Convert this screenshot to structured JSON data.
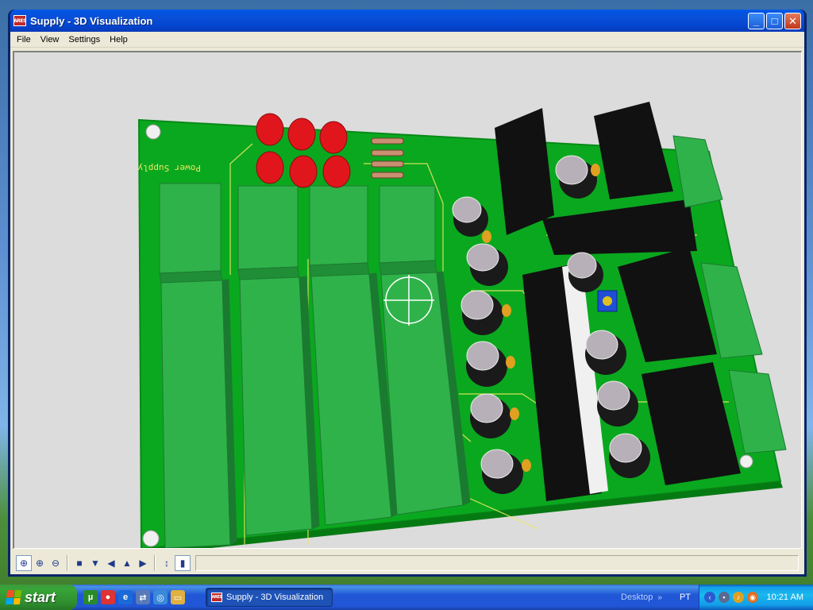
{
  "window": {
    "title": "Supply - 3D Visualization",
    "app_icon_text": "ARES",
    "controls": {
      "minimize": "_",
      "maximize": "□",
      "close": "✕"
    }
  },
  "menu": [
    "File",
    "View",
    "Settings",
    "Help"
  ],
  "viewport": {
    "silkscreen_label": "Power Supply",
    "colors": {
      "background": "#dcdcdc",
      "board": "#0aa81f",
      "connector": "#2fb24a",
      "led": "#e0161c",
      "heatsink": "#111111",
      "capacitor_top": "#b8b0b8",
      "capacitor_body": "#1a1a1a",
      "trimpot": "#1f4fd6",
      "track": "#e8e860"
    }
  },
  "toolbar": {
    "tools": [
      {
        "name": "pan-icon",
        "glyph": "⊕",
        "active": true
      },
      {
        "name": "zoom-in-icon",
        "glyph": "⊕"
      },
      {
        "name": "zoom-out-icon",
        "glyph": "⊖"
      },
      {
        "name": "view-top-icon",
        "glyph": "■"
      },
      {
        "name": "view-front-icon",
        "glyph": "▼"
      },
      {
        "name": "view-left-icon",
        "glyph": "◀"
      },
      {
        "name": "view-back-icon",
        "glyph": "▲"
      },
      {
        "name": "view-right-icon",
        "glyph": "▶"
      },
      {
        "name": "height-scale-icon",
        "glyph": "↕"
      },
      {
        "name": "component-toggle-icon",
        "glyph": "▮",
        "active": true
      }
    ]
  },
  "taskbar": {
    "start_label": "start",
    "task_title": "Supply - 3D Visualization",
    "desktop_label": "Desktop",
    "language": "PT",
    "clock": "10:21 AM"
  }
}
